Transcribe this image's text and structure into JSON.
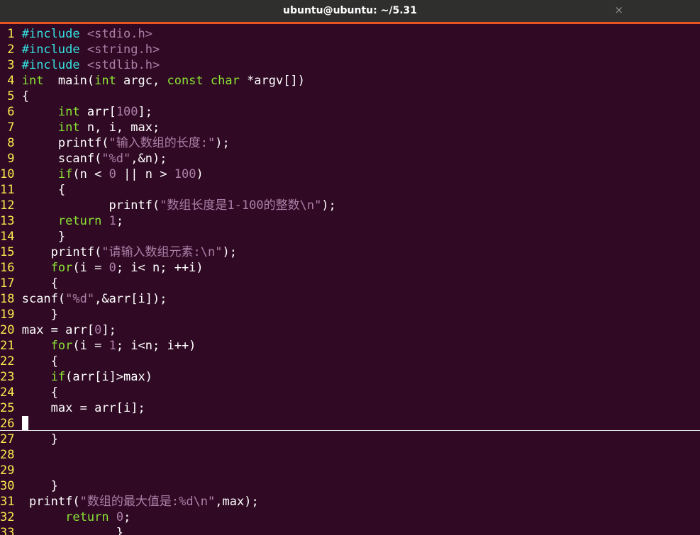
{
  "window": {
    "title": "ubuntu@ubuntu: ~/5.31",
    "close_glyph": "×"
  },
  "code_lines": [
    {
      "n": "1",
      "segs": [
        [
          "pp",
          "#include "
        ],
        [
          "st",
          "<stdio.h>"
        ]
      ]
    },
    {
      "n": "2",
      "segs": [
        [
          "pp",
          "#include "
        ],
        [
          "st",
          "<string.h>"
        ]
      ]
    },
    {
      "n": "3",
      "segs": [
        [
          "pp",
          "#include "
        ],
        [
          "st",
          "<stdlib.h>"
        ]
      ]
    },
    {
      "n": "4",
      "segs": [
        [
          "ty",
          "int"
        ],
        [
          "",
          "  main("
        ],
        [
          "ty",
          "int"
        ],
        [
          "",
          " argc, "
        ],
        [
          "ty",
          "const char"
        ],
        [
          "",
          " *argv[])"
        ]
      ]
    },
    {
      "n": "5",
      "segs": [
        [
          "",
          "{"
        ]
      ]
    },
    {
      "n": "6",
      "segs": [
        [
          "",
          "     "
        ],
        [
          "ty",
          "int"
        ],
        [
          "",
          " arr["
        ],
        [
          "nu",
          "100"
        ],
        [
          "",
          "];"
        ]
      ]
    },
    {
      "n": "7",
      "segs": [
        [
          "",
          "     "
        ],
        [
          "ty",
          "int"
        ],
        [
          "",
          " n, i, max;"
        ]
      ]
    },
    {
      "n": "8",
      "segs": [
        [
          "",
          "     printf("
        ],
        [
          "st",
          "\"输入数组的长度:\""
        ],
        [
          "",
          ");"
        ]
      ]
    },
    {
      "n": "9",
      "segs": [
        [
          "",
          "     scanf("
        ],
        [
          "st",
          "\"%d\""
        ],
        [
          "",
          ",&n);"
        ]
      ]
    },
    {
      "n": "10",
      "segs": [
        [
          "",
          "     "
        ],
        [
          "ty",
          "if"
        ],
        [
          "",
          "(n < "
        ],
        [
          "nu",
          "0"
        ],
        [
          "",
          " || n > "
        ],
        [
          "nu",
          "100"
        ],
        [
          "",
          ")"
        ]
      ]
    },
    {
      "n": "11",
      "segs": [
        [
          "",
          "     {"
        ]
      ]
    },
    {
      "n": "12",
      "segs": [
        [
          "",
          "            printf("
        ],
        [
          "st",
          "\"数组长度是1-100的整数\\n\""
        ],
        [
          "",
          ");"
        ]
      ]
    },
    {
      "n": "13",
      "segs": [
        [
          "",
          "     "
        ],
        [
          "ty",
          "return"
        ],
        [
          "",
          " "
        ],
        [
          "nu",
          "1"
        ],
        [
          "",
          ";"
        ]
      ]
    },
    {
      "n": "14",
      "segs": [
        [
          "",
          "     }"
        ]
      ]
    },
    {
      "n": "15",
      "segs": [
        [
          "",
          "    printf("
        ],
        [
          "st",
          "\"请输入数组元素:\\n\""
        ],
        [
          "",
          ");"
        ]
      ]
    },
    {
      "n": "16",
      "segs": [
        [
          "",
          "    "
        ],
        [
          "ty",
          "for"
        ],
        [
          "",
          "(i = "
        ],
        [
          "nu",
          "0"
        ],
        [
          "",
          "; i< n; ++i)"
        ]
      ]
    },
    {
      "n": "17",
      "segs": [
        [
          "",
          "    {"
        ]
      ]
    },
    {
      "n": "18",
      "segs": [
        [
          "",
          "scanf("
        ],
        [
          "st",
          "\"%d\""
        ],
        [
          "",
          ",&arr[i]);"
        ]
      ]
    },
    {
      "n": "19",
      "segs": [
        [
          "",
          "    }"
        ]
      ]
    },
    {
      "n": "20",
      "segs": [
        [
          "",
          "max = arr["
        ],
        [
          "nu",
          "0"
        ],
        [
          "",
          "];"
        ]
      ]
    },
    {
      "n": "21",
      "segs": [
        [
          "",
          "    "
        ],
        [
          "ty",
          "for"
        ],
        [
          "",
          "(i = "
        ],
        [
          "nu",
          "1"
        ],
        [
          "",
          "; i<n; i++)"
        ]
      ]
    },
    {
      "n": "22",
      "segs": [
        [
          "",
          "    {"
        ]
      ]
    },
    {
      "n": "23",
      "segs": [
        [
          "",
          "    "
        ],
        [
          "ty",
          "if"
        ],
        [
          "",
          "(arr[i]>max)"
        ]
      ]
    },
    {
      "n": "24",
      "segs": [
        [
          "",
          "    {"
        ]
      ]
    },
    {
      "n": "25",
      "segs": [
        [
          "",
          "    max = arr[i];"
        ]
      ]
    },
    {
      "n": "26",
      "segs": [],
      "cursor": true
    },
    {
      "n": "27",
      "segs": [
        [
          "",
          "    }"
        ]
      ]
    },
    {
      "n": "28",
      "segs": []
    },
    {
      "n": "29",
      "segs": []
    },
    {
      "n": "30",
      "segs": [
        [
          "",
          "    }"
        ]
      ]
    },
    {
      "n": "31",
      "segs": [
        [
          "",
          " printf("
        ],
        [
          "st",
          "\"数组的最大值是:%d\\n\""
        ],
        [
          "",
          ",max);"
        ]
      ]
    },
    {
      "n": "32",
      "segs": [
        [
          "",
          "      "
        ],
        [
          "ty",
          "return"
        ],
        [
          "",
          " "
        ],
        [
          "nu",
          "0"
        ],
        [
          "",
          ";"
        ]
      ]
    },
    {
      "n": "33",
      "segs": [
        [
          "",
          "             }"
        ]
      ]
    }
  ]
}
